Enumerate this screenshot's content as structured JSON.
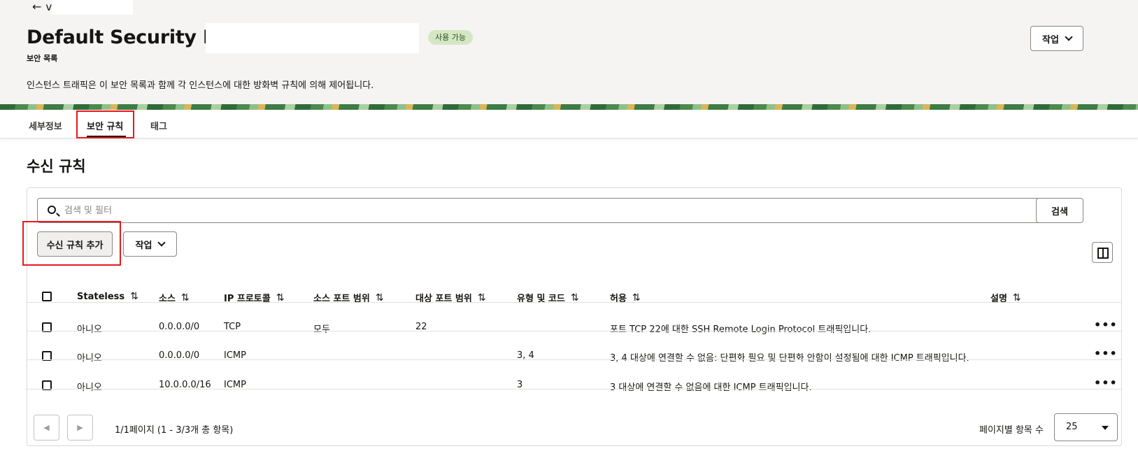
{
  "header": {
    "back_label": "v",
    "title": "Default Security List",
    "subtitle": "보안 목록",
    "status_badge": "사용 가능",
    "description": "인스턴스 트래픽은 이 보안 목록과 함께 각 인스턴스에 대한 방화벽 규칙에 의해 제어됩니다.",
    "actions_label": "작업"
  },
  "tabs": [
    {
      "label": "세부정보"
    },
    {
      "label": "보안 규칙"
    },
    {
      "label": "태그"
    }
  ],
  "section": {
    "title": "수신 규칙"
  },
  "search": {
    "placeholder": "검색 및 필터",
    "button_label": "검색"
  },
  "toolbar": {
    "add_label": "수신 규칙 추가",
    "actions_label": "작업"
  },
  "table": {
    "columns": [
      "Stateless",
      "소스",
      "IP 프로토콜",
      "소스 포트 범위",
      "대상 포트 범위",
      "유형 및 코드",
      "허용",
      "설명"
    ],
    "rows": [
      {
        "stateless": "아니오",
        "source": "0.0.0.0/0",
        "protocol": "TCP",
        "src_port": "모두",
        "dst_port": "22",
        "type_code": "",
        "allows": "포트 TCP 22에 대한 SSH Remote Login Protocol 트래픽입니다.",
        "description": ""
      },
      {
        "stateless": "아니오",
        "source": "0.0.0.0/0",
        "protocol": "ICMP",
        "src_port": "",
        "dst_port": "",
        "type_code": "3, 4",
        "allows": "3, 4 대상에 연결할 수 없음: 단편화 필요 및 단편화 안함이 설정됨에 대한 ICMP 트래픽입니다.",
        "description": ""
      },
      {
        "stateless": "아니오",
        "source": "10.0.0.0/16",
        "protocol": "ICMP",
        "src_port": "",
        "dst_port": "",
        "type_code": "3",
        "allows": "3 대상에 연결할 수 없음에 대한 ICMP 트래픽입니다.",
        "description": ""
      }
    ]
  },
  "pagination": {
    "info": "1/1페이지 (1 - 3/3개 총 항목)",
    "per_page_label": "페이지별 항목 수",
    "per_page_value": "25"
  },
  "icons": {
    "sort": "⇅",
    "more": "•••",
    "prev": "◀",
    "next": "▶",
    "back": "←"
  },
  "colors": {
    "header_bg": "#f5f4f2",
    "badge_bg": "#d4e7c5",
    "highlight": "#e8181c",
    "text": "#161513"
  }
}
